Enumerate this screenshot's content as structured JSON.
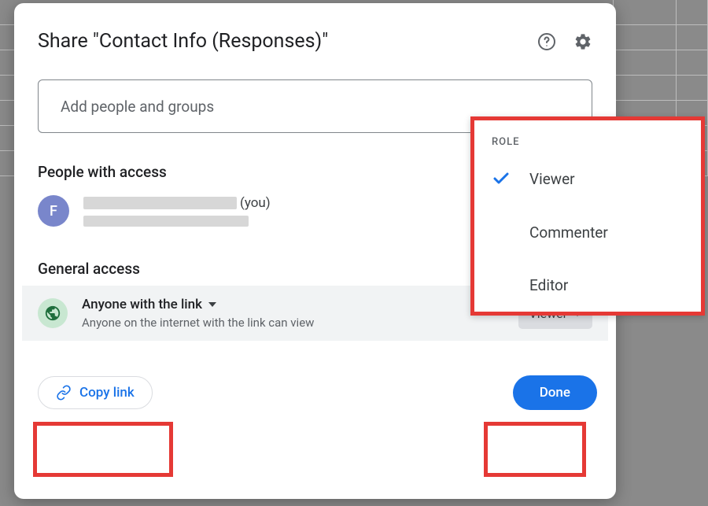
{
  "dialog": {
    "title": "Share \"Contact Info (Responses)\"",
    "add_placeholder": "Add people and groups",
    "people_section_label": "People with access",
    "person": {
      "initial": "F",
      "you_suffix": "(you)"
    },
    "general_section_label": "General access",
    "general": {
      "title": "Anyone with the link",
      "description": "Anyone on the internet with the link can view",
      "role_selected": "Viewer"
    },
    "footer": {
      "copy_link": "Copy link",
      "done": "Done"
    }
  },
  "role_menu": {
    "header": "ROLE",
    "items": [
      {
        "label": "Viewer",
        "selected": true
      },
      {
        "label": "Commenter",
        "selected": false
      },
      {
        "label": "Editor",
        "selected": false
      }
    ]
  }
}
